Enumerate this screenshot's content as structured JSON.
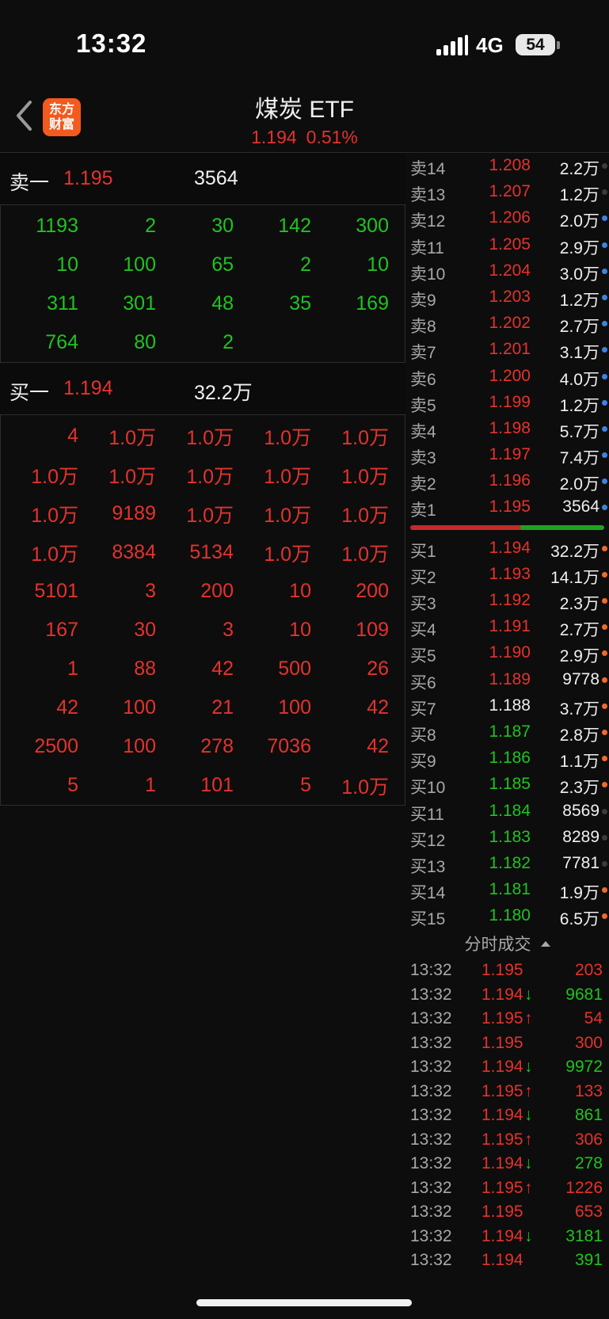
{
  "status": {
    "time": "13:32",
    "network": "4G",
    "battery": "54"
  },
  "header": {
    "logo_line1": "东方",
    "logo_line2": "财富",
    "title": "煤炭 ETF",
    "price": "1.194",
    "change_pct": "0.51%"
  },
  "sell_one": {
    "label": "卖一",
    "price": "1.195",
    "volume": "3564"
  },
  "sell_queue": [
    [
      "1193",
      "2",
      "30",
      "142",
      "300"
    ],
    [
      "10",
      "100",
      "65",
      "2",
      "10"
    ],
    [
      "311",
      "301",
      "48",
      "35",
      "169"
    ],
    [
      "764",
      "80",
      "2",
      "",
      ""
    ]
  ],
  "buy_one": {
    "label": "买一",
    "price": "1.194",
    "volume": "32.2万"
  },
  "buy_queue": [
    [
      "4",
      "1.0万",
      "1.0万",
      "1.0万",
      "1.0万"
    ],
    [
      "1.0万",
      "1.0万",
      "1.0万",
      "1.0万",
      "1.0万"
    ],
    [
      "1.0万",
      "9189",
      "1.0万",
      "1.0万",
      "1.0万"
    ],
    [
      "1.0万",
      "8384",
      "5134",
      "1.0万",
      "1.0万"
    ],
    [
      "5101",
      "3",
      "200",
      "10",
      "200"
    ],
    [
      "167",
      "30",
      "3",
      "10",
      "109"
    ],
    [
      "1",
      "88",
      "42",
      "500",
      "26"
    ],
    [
      "42",
      "100",
      "21",
      "100",
      "42"
    ],
    [
      "2500",
      "100",
      "278",
      "7036",
      "42"
    ],
    [
      "5",
      "1",
      "101",
      "5",
      "1.0万"
    ]
  ],
  "asks": [
    {
      "label": "卖14",
      "price": "1.208",
      "vol": "2.2万",
      "dot": "#3a3a3a"
    },
    {
      "label": "卖13",
      "price": "1.207",
      "vol": "1.2万",
      "dot": "#3a3a3a"
    },
    {
      "label": "卖12",
      "price": "1.206",
      "vol": "2.0万",
      "dot": "#3b82e6"
    },
    {
      "label": "卖11",
      "price": "1.205",
      "vol": "2.9万",
      "dot": "#3b82e6"
    },
    {
      "label": "卖10",
      "price": "1.204",
      "vol": "3.0万",
      "dot": "#3b82e6"
    },
    {
      "label": "卖9",
      "price": "1.203",
      "vol": "1.2万",
      "dot": "#3b82e6"
    },
    {
      "label": "卖8",
      "price": "1.202",
      "vol": "2.7万",
      "dot": "#3b82e6"
    },
    {
      "label": "卖7",
      "price": "1.201",
      "vol": "3.1万",
      "dot": "#3b82e6"
    },
    {
      "label": "卖6",
      "price": "1.200",
      "vol": "4.0万",
      "dot": "#3b82e6"
    },
    {
      "label": "卖5",
      "price": "1.199",
      "vol": "1.2万",
      "dot": "#3b82e6"
    },
    {
      "label": "卖4",
      "price": "1.198",
      "vol": "5.7万",
      "dot": "#3b82e6"
    },
    {
      "label": "卖3",
      "price": "1.197",
      "vol": "7.4万",
      "dot": "#3b82e6"
    },
    {
      "label": "卖2",
      "price": "1.196",
      "vol": "2.0万",
      "dot": "#3b82e6"
    },
    {
      "label": "卖1",
      "price": "1.195",
      "vol": "3564",
      "dot": "#3b82e6"
    }
  ],
  "bids": [
    {
      "label": "买1",
      "price": "1.194",
      "vol": "32.2万",
      "color": "red",
      "dot": "#f06a28"
    },
    {
      "label": "买2",
      "price": "1.193",
      "vol": "14.1万",
      "color": "red",
      "dot": "#f06a28"
    },
    {
      "label": "买3",
      "price": "1.192",
      "vol": "2.3万",
      "color": "red",
      "dot": "#f06a28"
    },
    {
      "label": "买4",
      "price": "1.191",
      "vol": "2.7万",
      "color": "red",
      "dot": "#f06a28"
    },
    {
      "label": "买5",
      "price": "1.190",
      "vol": "2.9万",
      "color": "red",
      "dot": "#f06a28"
    },
    {
      "label": "买6",
      "price": "1.189",
      "vol": "9778",
      "color": "red",
      "dot": "#f06a28"
    },
    {
      "label": "买7",
      "price": "1.188",
      "vol": "3.7万",
      "color": "white",
      "dot": "#f06a28"
    },
    {
      "label": "买8",
      "price": "1.187",
      "vol": "2.8万",
      "color": "green",
      "dot": "#f06a28"
    },
    {
      "label": "买9",
      "price": "1.186",
      "vol": "1.1万",
      "color": "green",
      "dot": "#f06a28"
    },
    {
      "label": "买10",
      "price": "1.185",
      "vol": "2.3万",
      "color": "green",
      "dot": "#f06a28"
    },
    {
      "label": "买11",
      "price": "1.184",
      "vol": "8569",
      "color": "green",
      "dot": "#3a3a3a"
    },
    {
      "label": "买12",
      "price": "1.183",
      "vol": "8289",
      "color": "green",
      "dot": "#3a3a3a"
    },
    {
      "label": "买13",
      "price": "1.182",
      "vol": "7781",
      "color": "green",
      "dot": "#3a3a3a"
    },
    {
      "label": "买14",
      "price": "1.181",
      "vol": "1.9万",
      "color": "green",
      "dot": "#f06a28"
    },
    {
      "label": "买15",
      "price": "1.180",
      "vol": "6.5万",
      "color": "green",
      "dot": "#f06a28"
    }
  ],
  "trades_title": "分时成交",
  "trades": [
    {
      "time": "13:32",
      "price": "1.195",
      "arrow": "",
      "vol": "203",
      "vcolor": "red"
    },
    {
      "time": "13:32",
      "price": "1.194",
      "arrow": "↓",
      "vol": "9681",
      "vcolor": "green"
    },
    {
      "time": "13:32",
      "price": "1.195",
      "arrow": "↑",
      "vol": "54",
      "vcolor": "red"
    },
    {
      "time": "13:32",
      "price": "1.195",
      "arrow": "",
      "vol": "300",
      "vcolor": "red"
    },
    {
      "time": "13:32",
      "price": "1.194",
      "arrow": "↓",
      "vol": "9972",
      "vcolor": "green"
    },
    {
      "time": "13:32",
      "price": "1.195",
      "arrow": "↑",
      "vol": "133",
      "vcolor": "red"
    },
    {
      "time": "13:32",
      "price": "1.194",
      "arrow": "↓",
      "vol": "861",
      "vcolor": "green"
    },
    {
      "time": "13:32",
      "price": "1.195",
      "arrow": "↑",
      "vol": "306",
      "vcolor": "red"
    },
    {
      "time": "13:32",
      "price": "1.194",
      "arrow": "↓",
      "vol": "278",
      "vcolor": "green"
    },
    {
      "time": "13:32",
      "price": "1.195",
      "arrow": "↑",
      "vol": "1226",
      "vcolor": "red"
    },
    {
      "time": "13:32",
      "price": "1.195",
      "arrow": "",
      "vol": "653",
      "vcolor": "red"
    },
    {
      "time": "13:32",
      "price": "1.194",
      "arrow": "↓",
      "vol": "3181",
      "vcolor": "green"
    },
    {
      "time": "13:32",
      "price": "1.194",
      "arrow": "",
      "vol": "391",
      "vcolor": "green"
    }
  ]
}
